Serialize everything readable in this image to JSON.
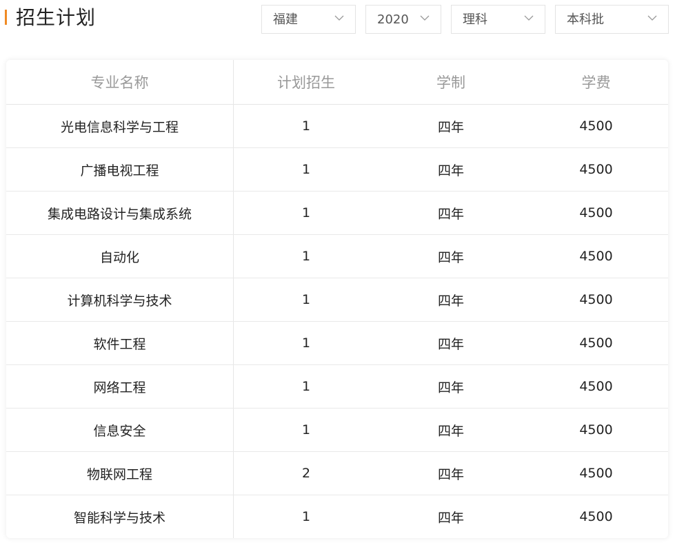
{
  "header": {
    "title": "招生计划",
    "accent_color": "#f08a24"
  },
  "filters": {
    "province": "福建",
    "year": "2020",
    "subject": "理科",
    "batch": "本科批"
  },
  "table": {
    "columns": [
      "专业名称",
      "计划招生",
      "学制",
      "学费"
    ],
    "rows": [
      {
        "name": "光电信息科学与工程",
        "plan": "1",
        "duration": "四年",
        "fee": "4500"
      },
      {
        "name": "广播电视工程",
        "plan": "1",
        "duration": "四年",
        "fee": "4500"
      },
      {
        "name": "集成电路设计与集成系统",
        "plan": "1",
        "duration": "四年",
        "fee": "4500"
      },
      {
        "name": "自动化",
        "plan": "1",
        "duration": "四年",
        "fee": "4500"
      },
      {
        "name": "计算机科学与技术",
        "plan": "1",
        "duration": "四年",
        "fee": "4500"
      },
      {
        "name": "软件工程",
        "plan": "1",
        "duration": "四年",
        "fee": "4500"
      },
      {
        "name": "网络工程",
        "plan": "1",
        "duration": "四年",
        "fee": "4500"
      },
      {
        "name": "信息安全",
        "plan": "1",
        "duration": "四年",
        "fee": "4500"
      },
      {
        "name": "物联网工程",
        "plan": "2",
        "duration": "四年",
        "fee": "4500"
      },
      {
        "name": "智能科学与技术",
        "plan": "1",
        "duration": "四年",
        "fee": "4500"
      }
    ]
  }
}
